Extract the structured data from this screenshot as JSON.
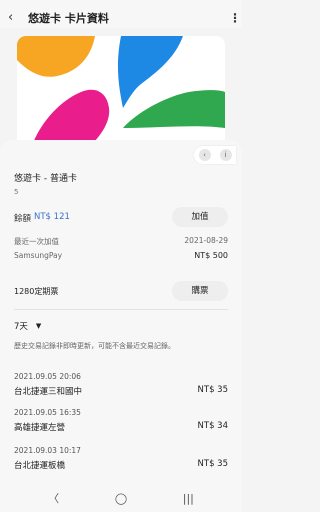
{
  "appbar": {
    "back_icon": "back-arrow-icon",
    "title": "悠遊卡 卡片資料",
    "more_icon": "more-vert-icon"
  },
  "card": {
    "name": "悠遊卡 - 普通卡",
    "number": "5",
    "colors": {
      "orange": "#f6a623",
      "blue": "#1e88e5",
      "magenta": "#e91e8c",
      "green": "#2fa84f"
    }
  },
  "balance": {
    "label": "餘額",
    "value": "NT$ 121",
    "button": "加值"
  },
  "last_topup": {
    "label": "最近一次加值",
    "date": "2021-08-29",
    "source": "SamsungPay",
    "amount": "NT$ 500"
  },
  "ticket": {
    "label": "1280定期票",
    "button": "購票"
  },
  "history": {
    "period": "7天",
    "notice": "歷史交易記錄非即時更新，可能不含最近交易記錄。",
    "transactions": [
      {
        "datetime": "2021.09.05 20:06",
        "station": "台北捷運三和國中",
        "amount": "NT$ 35"
      },
      {
        "datetime": "2021.09.05 16:35",
        "station": "高雄捷運左營",
        "amount": "NT$ 34"
      },
      {
        "datetime": "2021.09.03 10:17",
        "station": "台北捷運板橋",
        "amount": "NT$ 35"
      }
    ]
  },
  "side_pill": {
    "left": "‹",
    "right": "i"
  },
  "navbar": {
    "back": "〈",
    "home": "◯",
    "recents": "|||"
  }
}
